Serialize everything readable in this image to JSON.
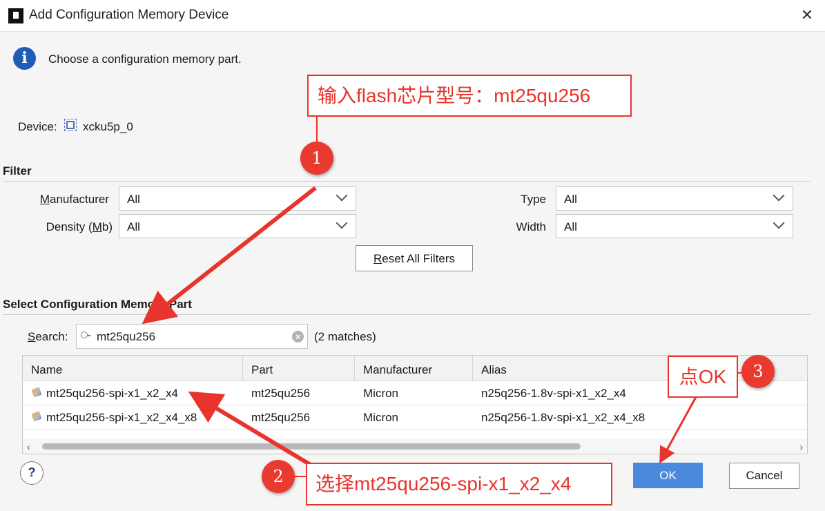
{
  "window": {
    "title": "Add Configuration Memory Device",
    "close": "✕"
  },
  "prompt": "Choose a configuration memory part.",
  "device": {
    "label": "Device:",
    "value": "xcku5p_0"
  },
  "filter": {
    "heading": "Filter",
    "manufacturer": {
      "label_u": "M",
      "label_rest": "anufacturer",
      "value": "All"
    },
    "density": {
      "label_pre": "Density (",
      "label_u": "M",
      "label_post": "b)",
      "value": "All"
    },
    "type": {
      "label": "Type",
      "value": "All"
    },
    "width": {
      "label": "Width",
      "value": "All"
    },
    "reset_u": "R",
    "reset_rest": "eset All Filters"
  },
  "select_section": {
    "heading": "Select Configuration Memory Part",
    "search_label_u": "S",
    "search_label_rest": "earch:",
    "search_value": "mt25qu256",
    "matches": "(2 matches)"
  },
  "table": {
    "columns": [
      "Name",
      "Part",
      "Manufacturer",
      "Alias"
    ],
    "rows": [
      {
        "name": "mt25qu256-spi-x1_x2_x4",
        "part": "mt25qu256",
        "manufacturer": "Micron",
        "alias": "n25q256-1.8v-spi-x1_x2_x4"
      },
      {
        "name": "mt25qu256-spi-x1_x2_x4_x8",
        "part": "mt25qu256",
        "manufacturer": "Micron",
        "alias": "n25q256-1.8v-spi-x1_x2_x4_x8"
      }
    ]
  },
  "buttons": {
    "help": "?",
    "ok": "OK",
    "cancel": "Cancel"
  },
  "annotations": {
    "callout1": "输入flash芯片型号：mt25qu256",
    "callout2": "选择mt25qu256-spi-x1_x2_x4",
    "callout3": "点OK",
    "badge1": "1",
    "badge2": "2",
    "badge3": "3",
    "color": "#e8342c"
  },
  "icons": [
    "app-logo-icon",
    "close-icon",
    "info-icon",
    "chip-icon",
    "chevron-down-icon",
    "search-icon",
    "clear-icon",
    "part-icon",
    "help-icon"
  ]
}
